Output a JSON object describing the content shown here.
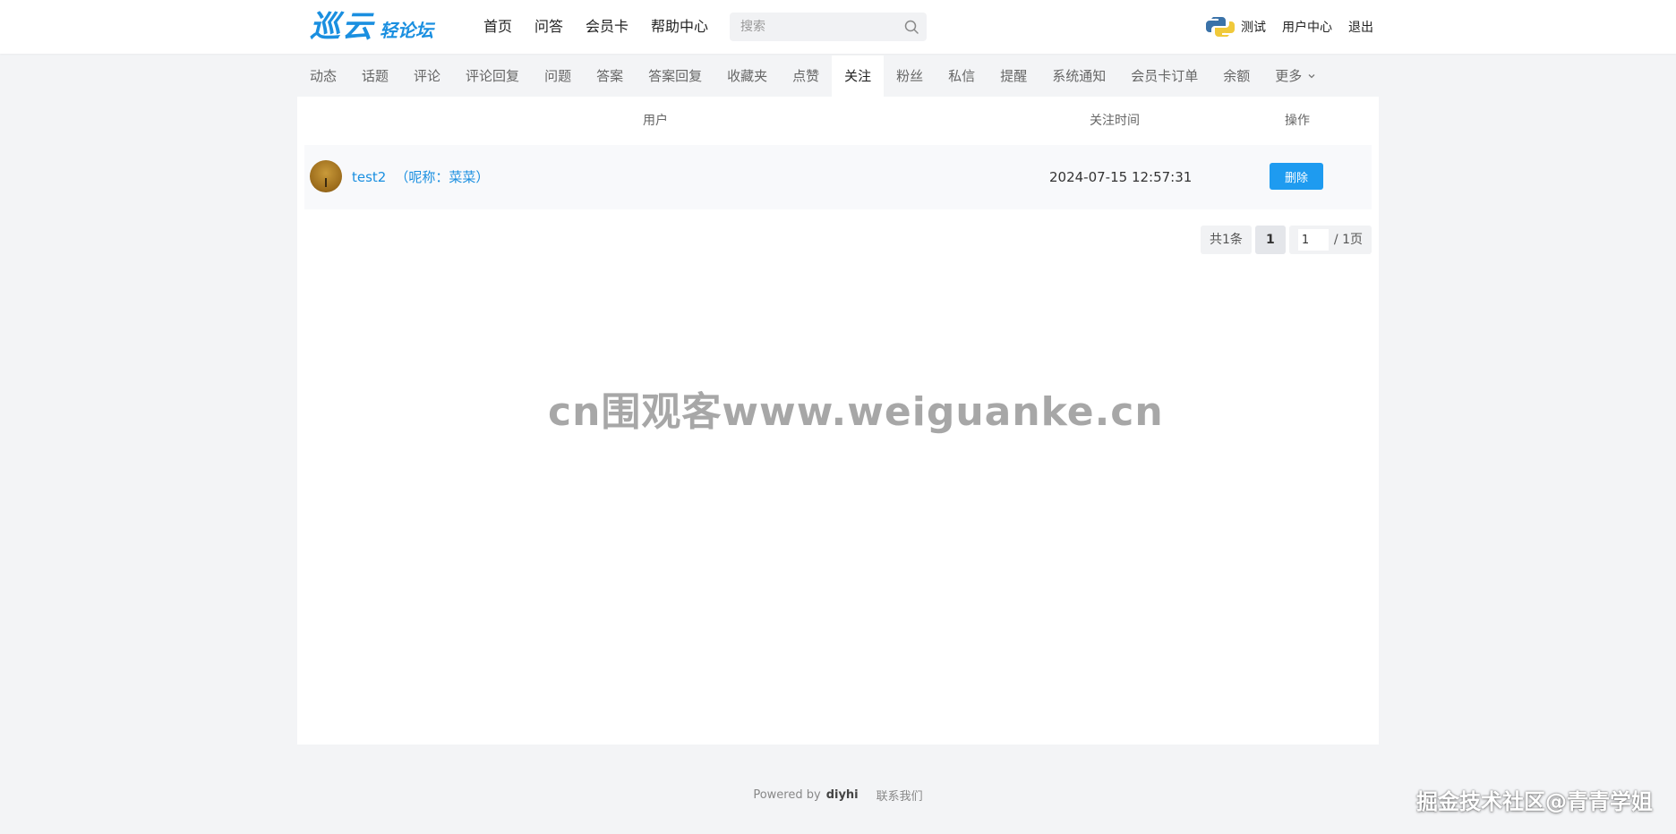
{
  "header": {
    "logo_main": "巡云",
    "logo_sub": "轻论坛",
    "nav": [
      "首页",
      "问答",
      "会员卡",
      "帮助中心"
    ],
    "search_placeholder": "搜索",
    "username": "测试",
    "user_center": "用户中心",
    "logout": "退出"
  },
  "sub_nav": {
    "items": [
      "动态",
      "话题",
      "评论",
      "评论回复",
      "问题",
      "答案",
      "答案回复",
      "收藏夹",
      "点赞",
      "关注",
      "粉丝",
      "私信",
      "提醒",
      "系统通知",
      "会员卡订单",
      "余额",
      "更多"
    ],
    "active": "关注"
  },
  "table": {
    "columns": {
      "user": "用户",
      "time": "关注时间",
      "action": "操作"
    },
    "rows": [
      {
        "username": "test2",
        "nickname": "（呢称：菜菜）",
        "time": "2024-07-15 12:57:31",
        "action_label": "删除"
      }
    ]
  },
  "pagination": {
    "total": "共1条",
    "current": "1",
    "jump_value": "1",
    "pages": "/ 1页"
  },
  "watermark": "cn围观客www.weiguanke.cn",
  "footer": {
    "powered_by": "Powered by",
    "brand": "diyhi",
    "contact": "联系我们"
  },
  "corner_mark": "掘金技术社区@青青学姐",
  "colors": {
    "accent": "#1e9bf0",
    "link": "#1a8fe0",
    "page_bg": "#f3f4f6"
  }
}
